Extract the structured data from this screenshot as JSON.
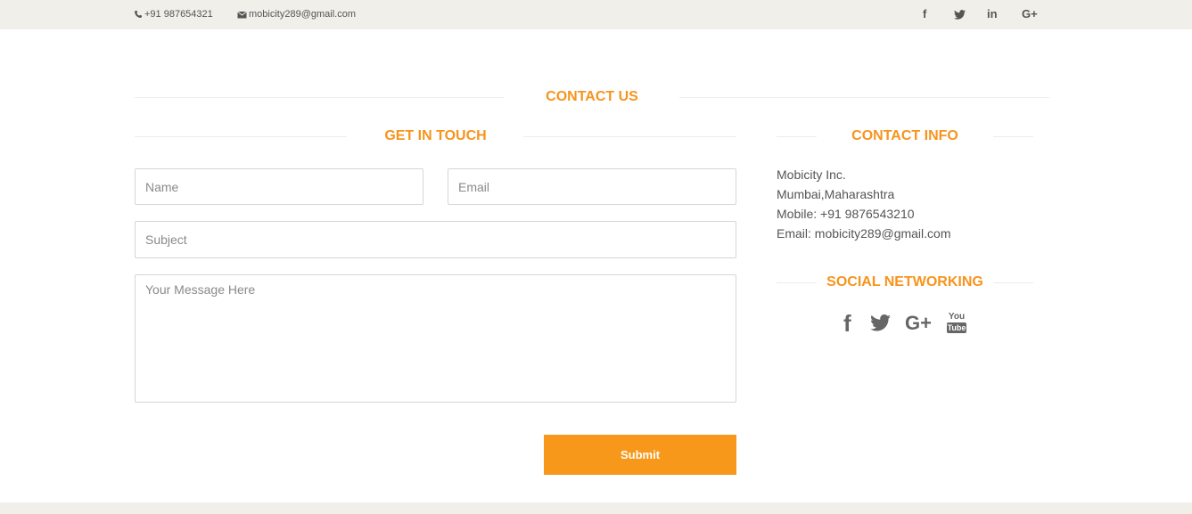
{
  "topbar": {
    "phone": "+91 987654321",
    "email": "mobicity289@gmail.com",
    "social_icons": [
      "facebook-icon",
      "twitter-icon",
      "linkedin-icon",
      "google-plus-icon"
    ],
    "social_labels": {
      "facebook": "f",
      "linkedin": "in",
      "googleplus": "G+"
    }
  },
  "contact_us": {
    "title": "CONTACT US"
  },
  "get_in_touch": {
    "title": "GET IN TOUCH",
    "name_placeholder": "Name",
    "email_placeholder": "Email",
    "subject_placeholder": "Subject",
    "message_placeholder": "Your Message Here",
    "submit_label": "Submit"
  },
  "contact_info": {
    "title": "CONTACT INFO",
    "company": "Mobicity Inc.",
    "address": "Mumbai,Maharashtra",
    "mobile": "Mobile: +91 9876543210",
    "email": "Email: mobicity289@gmail.com"
  },
  "social_networking": {
    "title": "SOCIAL NETWORKING",
    "icons": [
      "facebook-icon",
      "twitter-icon",
      "google-plus-icon",
      "youtube-icon"
    ],
    "labels": {
      "facebook": "f",
      "googleplus": "G+",
      "youtube_top": "You",
      "youtube_bottom": "Tube"
    }
  },
  "colors": {
    "accent": "#f7941d",
    "button": "#f7981a",
    "topbar_bg": "#f0efe9",
    "text": "#555555"
  }
}
